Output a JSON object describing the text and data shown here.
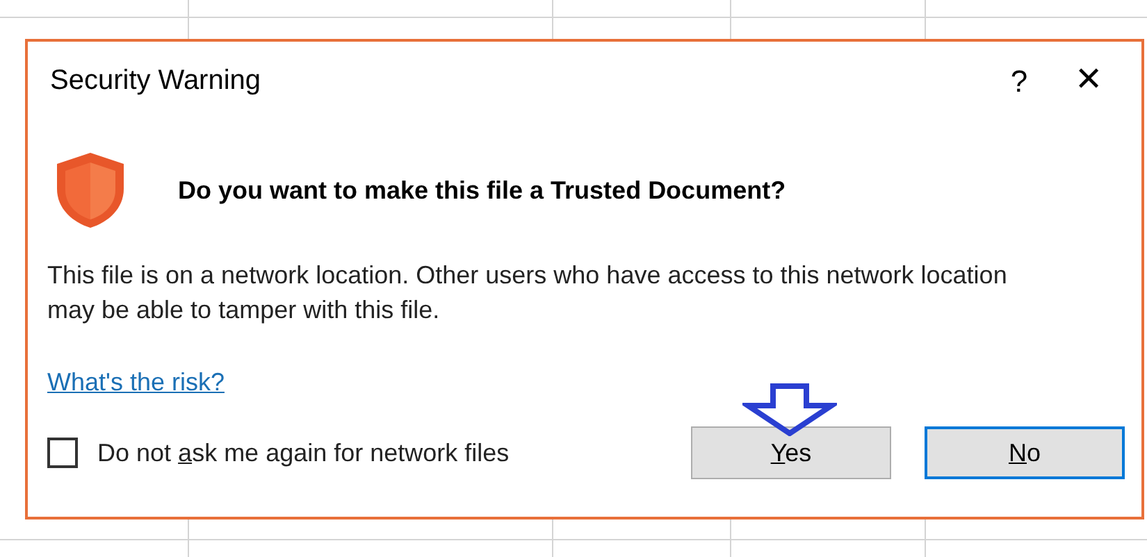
{
  "dialog": {
    "title": "Security Warning",
    "help": "?",
    "close": "✕"
  },
  "question": "Do you want to make this file a Trusted Document?",
  "message": "This file is on a network location. Other users who have access to this network location may be able to tamper with this file.",
  "link": "What's the risk?",
  "checkbox": {
    "before": "Do not ",
    "key": "a",
    "after": "sk me again for network files",
    "checked": false
  },
  "buttons": [
    {
      "key": "Y",
      "after": "es",
      "default": false
    },
    {
      "key": "N",
      "after": "o",
      "default": true
    }
  ]
}
